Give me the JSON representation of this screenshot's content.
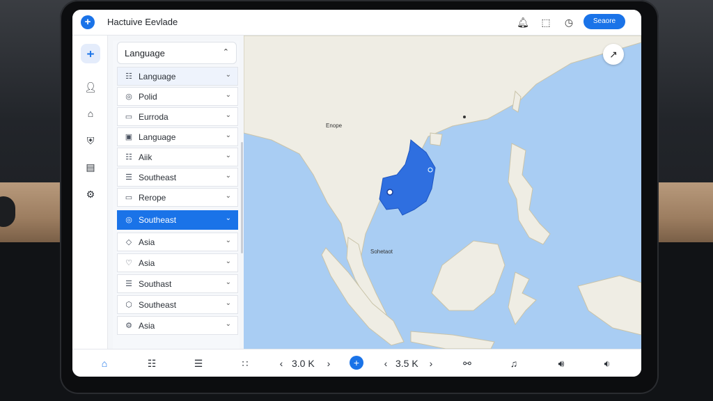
{
  "app": {
    "title": "Hactuive Eevlade",
    "action_button": "Seaore"
  },
  "header_icons": [
    "bell-icon",
    "screen-icon",
    "clock-icon"
  ],
  "rail": [
    "plus-icon",
    "person-icon",
    "home-icon",
    "shield-icon",
    "card-icon",
    "settings-icon"
  ],
  "panel": {
    "header": "Language",
    "items": [
      {
        "label": "Language",
        "icon": "translate-icon"
      },
      {
        "label": "Polid",
        "icon": "pin-icon"
      },
      {
        "label": "Eurroda",
        "icon": "screen-icon"
      },
      {
        "label": "Language",
        "icon": "panel-icon"
      },
      {
        "label": "Aiik",
        "icon": "grid-icon"
      },
      {
        "label": "Southeast",
        "icon": "doc-icon"
      },
      {
        "label": "Rerope",
        "icon": "card-icon"
      },
      {
        "label": "Southeast",
        "icon": "globe-icon",
        "selected": true
      },
      {
        "label": "Asia",
        "icon": "diamond-icon"
      },
      {
        "label": "Asia",
        "icon": "heart-icon"
      },
      {
        "label": "Southast",
        "icon": "doc-icon"
      },
      {
        "label": "Southeast",
        "icon": "hex-icon"
      },
      {
        "label": "Asia",
        "icon": "gear-icon"
      }
    ]
  },
  "map": {
    "labels": {
      "north": "Enope",
      "south": "Sohetaot"
    },
    "highlight_color": "#2f6fe0"
  },
  "bottom": {
    "value_left": "3.0 K",
    "value_right": "3.5 K"
  },
  "colors": {
    "accent": "#1a73e8",
    "sea": "#a9cdf3",
    "land": "#f0efe6"
  }
}
